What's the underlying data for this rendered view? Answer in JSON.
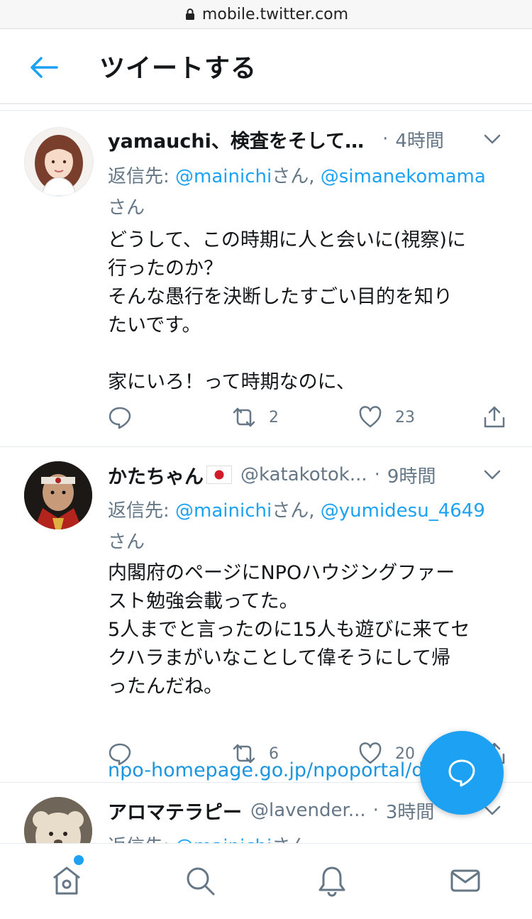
{
  "browser": {
    "url": "mobile.twitter.com"
  },
  "header": {
    "title": "ツイートする"
  },
  "tweets": [
    {
      "name": "yamauchi、検査をそして…",
      "handle": "",
      "dot": "·",
      "time": "4時間",
      "reply_prefix": "返信先: ",
      "reply_mention1": "@mainichi",
      "reply_san1": "さん, ",
      "reply_mention2": "@simanekomama",
      "reply_san2": "さん",
      "text": "どうして、この時期に人と会いに(視察)に\n行ったのか？\nそんな愚行を決断したすごい目的を知り\nたいです。\n\n家にいろ！って時期なのに、",
      "link": "",
      "retweets": "2",
      "likes": "23"
    },
    {
      "name": "かたちゃん",
      "handle": "@katakotok...",
      "dot": "·",
      "time": "9時間",
      "reply_prefix": "返信先: ",
      "reply_mention1": "@mainichi",
      "reply_san1": "さん, ",
      "reply_mention2": "@yumidesu_4649",
      "reply_san2": "さん",
      "text": "内閣府のページにNPOハウジングファー\nスト勉強会載ってた。\n5人までと言ったのに15人も遊びに来てセ\nクハラまがいなことして偉そうにして帰\nったんだね。",
      "link": "npo-homepage.go.jp/npoportal/deta…",
      "retweets": "6",
      "likes": "20"
    },
    {
      "name": "アロマテラピー",
      "handle": "@lavender...",
      "dot": "·",
      "time": "3時間",
      "reply_prefix": "返信先: ",
      "reply_mention1": "@mainichi",
      "reply_san1": "さん"
    }
  ],
  "colors": {
    "accent": "#1da1f2",
    "muted": "#657786",
    "text": "#14171a"
  },
  "icons": [
    "lock-icon",
    "back-arrow-icon",
    "chevron-down-icon",
    "reply-icon",
    "retweet-icon",
    "like-icon",
    "share-icon",
    "compose-reply-icon",
    "home-icon",
    "search-icon",
    "notifications-icon",
    "messages-icon"
  ]
}
